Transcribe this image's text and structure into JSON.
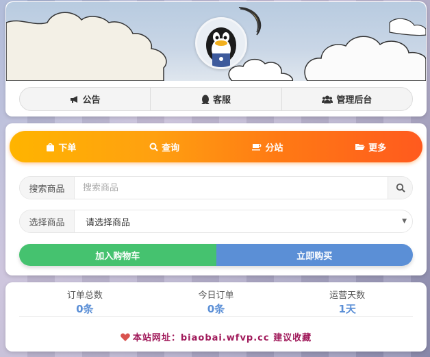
{
  "header": {
    "nav": [
      {
        "label": "公告",
        "icon": "bullhorn-icon"
      },
      {
        "label": "客服",
        "icon": "penguin-icon"
      },
      {
        "label": "管理后台",
        "icon": "users-icon"
      }
    ]
  },
  "order": {
    "tabs": [
      {
        "label": "下单",
        "icon": "shopping-bag-icon"
      },
      {
        "label": "查询",
        "icon": "search-icon"
      },
      {
        "label": "分站",
        "icon": "coffee-icon"
      },
      {
        "label": "更多",
        "icon": "folder-open-icon"
      }
    ],
    "search": {
      "label": "搜索商品",
      "placeholder": "搜索商品",
      "value": ""
    },
    "select": {
      "label": "选择商品",
      "value": "请选择商品"
    },
    "add_to_cart": "加入购物车",
    "buy_now": "立即购买"
  },
  "stats": {
    "items": [
      {
        "title": "订单总数",
        "value": "0条"
      },
      {
        "title": "今日订单",
        "value": "0条"
      },
      {
        "title": "运营天数",
        "value": "1天"
      }
    ],
    "site_text": "本站网址：biaobai.wfvp.cc  建议收藏"
  },
  "colors": {
    "tab_gradient_start": "#ffb400",
    "tab_gradient_end": "#ff5a1e",
    "cart_button": "#45c26f",
    "buy_button": "#5b8fd6",
    "stat_value": "#5b8fd6",
    "site_text": "#a0195a"
  }
}
